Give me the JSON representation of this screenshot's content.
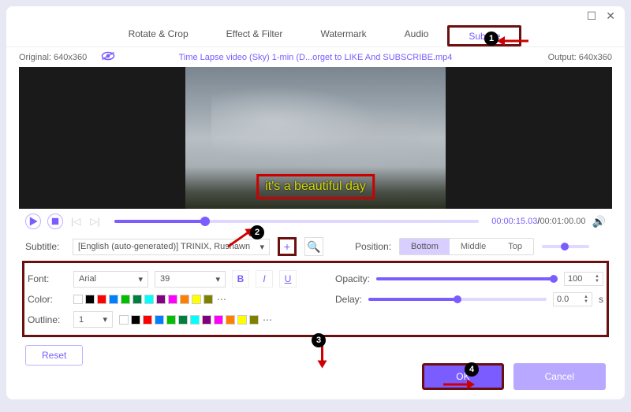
{
  "titlebar": {
    "max": "☐",
    "close": "✕"
  },
  "tabs": [
    "Rotate & Crop",
    "Effect & Filter",
    "Watermark",
    "Audio",
    "Subtitle"
  ],
  "activeTab": 4,
  "infobar": {
    "original": "Original: 640x360",
    "title": "Time Lapse video (Sky) 1-min (D...orget to LIKE And SUBSCRIBE.mp4",
    "output": "Output: 640x360"
  },
  "subtitleText": "it's a beautiful day",
  "playback": {
    "current": "00:00:15.03",
    "total": "00:01:00.00"
  },
  "subtitleRow": {
    "label": "Subtitle:",
    "value": "[English (auto-generated)] TRINIX, Rushawn",
    "positionLabel": "Position:",
    "positions": [
      "Bottom",
      "Middle",
      "Top"
    ],
    "activePos": 0
  },
  "style": {
    "fontLabel": "Font:",
    "fontValue": "Arial",
    "sizeValue": "39",
    "bold": "B",
    "italic": "I",
    "underline": "U",
    "opacityLabel": "Opacity:",
    "opacityValue": "100",
    "colorLabel": "Color:",
    "colorSwatches": [
      "#ffffff",
      "#000000",
      "#ff0000",
      "#0080ff",
      "#00c000",
      "#008040",
      "#00ffff",
      "#800080",
      "#ff00ff",
      "#ff8000",
      "#ffff00",
      "#808000"
    ],
    "delayLabel": "Delay:",
    "delayValue": "0.0",
    "delayUnit": "s",
    "outlineLabel": "Outline:",
    "outlineValue": "1",
    "outlineSwatches": [
      "#ffffff",
      "#000000",
      "#ff0000",
      "#0080ff",
      "#00c000",
      "#008040",
      "#00ffff",
      "#800080",
      "#ff00ff",
      "#ff8000",
      "#ffff00",
      "#808000"
    ]
  },
  "reset": "Reset",
  "footer": {
    "ok": "OK",
    "cancel": "Cancel"
  },
  "markers": [
    "1",
    "2",
    "3",
    "4"
  ]
}
